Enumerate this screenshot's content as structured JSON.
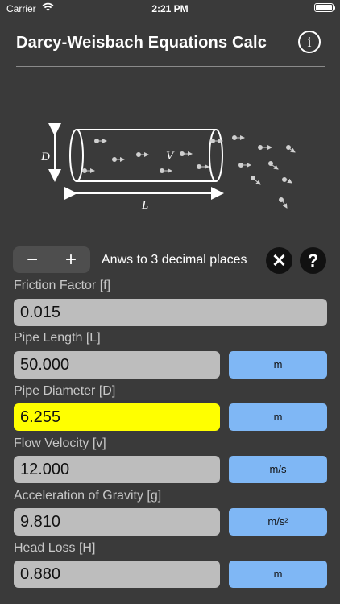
{
  "status": {
    "carrier": "Carrier",
    "time": "2:21 PM"
  },
  "header": {
    "title": "Darcy-Weisbach Equations Calc",
    "info_label": "i"
  },
  "diagram": {
    "diameter_label": "D",
    "length_label": "L",
    "velocity_label": "V"
  },
  "precision": {
    "minus_label": "−",
    "plus_label": "+",
    "text": "Anws to 3 decimal places",
    "clear_label": "✕",
    "help_label": "?"
  },
  "fields": [
    {
      "label": "Friction Factor [f]",
      "value": "0.015"
    },
    {
      "label": "Pipe Length [L]",
      "value": "50.000",
      "unit": "m"
    },
    {
      "label": "Pipe Diameter [D]",
      "value": "6.255",
      "unit": "m"
    },
    {
      "label": "Flow Velocity [v]",
      "value": "12.000",
      "unit": "m/s"
    },
    {
      "label": "Acceleration of Gravity [g]",
      "value": "9.810",
      "unit": "m/s²"
    },
    {
      "label": "Head Loss [H]",
      "value": "0.880",
      "unit": "m"
    }
  ],
  "colors": {
    "background": "#3a3a3a",
    "highlight": "#ffff00",
    "unit_button": "#7fb7f5"
  }
}
